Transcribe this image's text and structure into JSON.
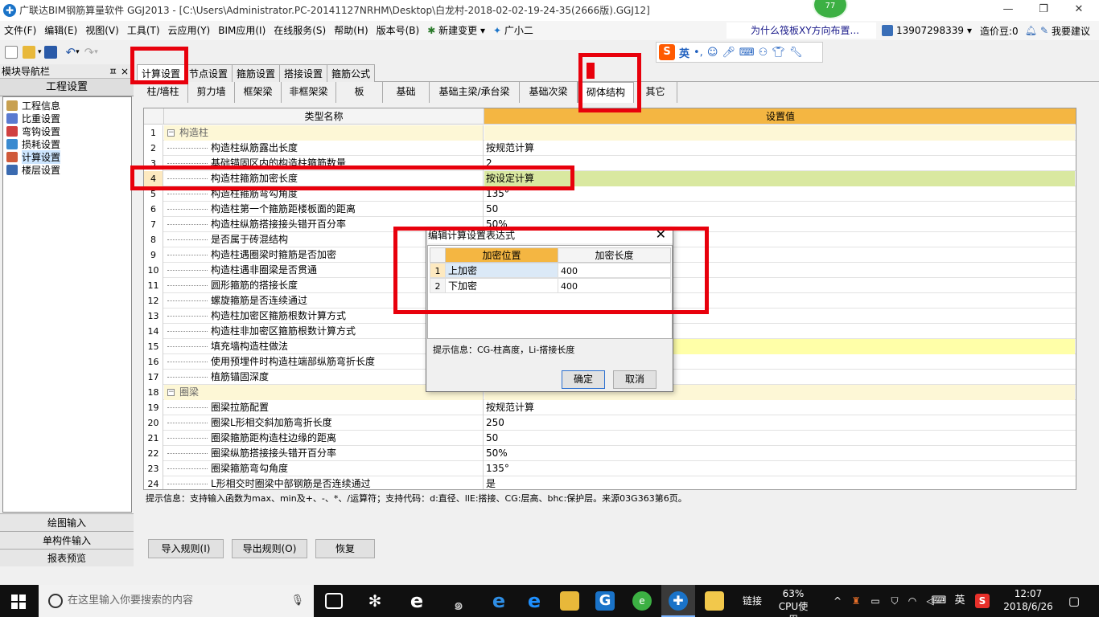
{
  "window": {
    "title": "广联达BIM钢筋算量软件 GGJ2013 - [C:\\Users\\Administrator.PC-20141127NRHM\\Desktop\\白龙村-2018-02-02-19-24-35(2666版).GGJ12]",
    "badge": "77",
    "controls": {
      "minimize": "—",
      "restore": "❐",
      "close": "✕"
    }
  },
  "menu": {
    "items": [
      "文件(F)",
      "编辑(E)",
      "视图(V)",
      "工具(T)",
      "云应用(Y)",
      "BIM应用(I)",
      "在线服务(S)",
      "帮助(H)",
      "版本号(B)",
      "新建变更",
      "广小二"
    ],
    "ad": "为什么筏板XY方向布置...",
    "phone": "13907298339",
    "bean": "造价豆:0",
    "feedback": "我要建议"
  },
  "ime": {
    "lang": "英"
  },
  "nav": {
    "title": "模块导航栏",
    "pin": "ㅍ",
    "close": "×",
    "section": "工程设置",
    "items": [
      "工程信息",
      "比重设置",
      "弯钩设置",
      "损耗设置",
      "计算设置",
      "楼层设置"
    ],
    "bottom": [
      "绘图输入",
      "单构件输入",
      "报表预览"
    ]
  },
  "tabs": [
    "计算设置",
    "节点设置",
    "箍筋设置",
    "搭接设置",
    "箍筋公式"
  ],
  "subtabs": [
    "柱/墙柱",
    "剪力墙",
    "框架梁",
    "非框架梁",
    "板",
    "基础",
    "基础主梁/承台梁",
    "基础次梁",
    "砌体结构",
    "其它"
  ],
  "grid": {
    "col_name": "类型名称",
    "col_value": "设置值",
    "rows": [
      {
        "n": "1",
        "name": "构造柱",
        "value": "",
        "group": true
      },
      {
        "n": "2",
        "name": "构造柱纵筋露出长度",
        "value": "按规范计算"
      },
      {
        "n": "3",
        "name": "基础锚固区内的构造柱箍筋数量",
        "value": "2"
      },
      {
        "n": "4",
        "name": "构造柱箍筋加密长度",
        "value": "按设定计算",
        "selected": true
      },
      {
        "n": "5",
        "name": "构造柱箍筋弯勾角度",
        "value": "135°"
      },
      {
        "n": "6",
        "name": "构造柱第一个箍筋距楼板面的距离",
        "value": "50"
      },
      {
        "n": "7",
        "name": "构造柱纵筋搭接接头错开百分率",
        "value": "50%"
      },
      {
        "n": "8",
        "name": "是否属于砖混结构",
        "value": ""
      },
      {
        "n": "9",
        "name": "构造柱遇圈梁时箍筋是否加密",
        "value": ""
      },
      {
        "n": "10",
        "name": "构造柱遇非圈梁是否贯通",
        "value": ""
      },
      {
        "n": "11",
        "name": "圆形箍筋的搭接长度",
        "value": ""
      },
      {
        "n": "12",
        "name": "螺旋箍筋是否连续通过",
        "value": ""
      },
      {
        "n": "13",
        "name": "构造柱加密区箍筋根数计算方式",
        "value": ""
      },
      {
        "n": "14",
        "name": "构造柱非加密区箍筋根数计算方式",
        "value": ""
      },
      {
        "n": "15",
        "name": "填充墙构造柱做法",
        "value": "",
        "hl": true
      },
      {
        "n": "16",
        "name": "使用预埋件时构造柱端部纵筋弯折长度",
        "value": ""
      },
      {
        "n": "17",
        "name": "植筋锚固深度",
        "value": ""
      },
      {
        "n": "18",
        "name": "圈梁",
        "value": "",
        "group": true
      },
      {
        "n": "19",
        "name": "圈梁拉筋配置",
        "value": "按规范计算"
      },
      {
        "n": "20",
        "name": "圈梁L形相交斜加筋弯折长度",
        "value": "250"
      },
      {
        "n": "21",
        "name": "圈梁箍筋距构造柱边缘的距离",
        "value": "50"
      },
      {
        "n": "22",
        "name": "圈梁纵筋搭接接头错开百分率",
        "value": "50%"
      },
      {
        "n": "23",
        "name": "圈梁箍筋弯勾角度",
        "value": "135°"
      },
      {
        "n": "24",
        "name": "L形相交时圈梁中部钢筋是否连续通过",
        "value": "是"
      }
    ]
  },
  "hint": "提示信息：支持输入函数为max、min及+、-、*、/运算符；支持代码：d:直径、llE:搭接、CG:层高、bhc:保护层。来源03G363第6页。",
  "buttons": {
    "import": "导入规则(I)",
    "export": "导出规则(O)",
    "restore": "恢复"
  },
  "dialog": {
    "title": "编辑计算设置表达式",
    "close": "✕",
    "col_position": "加密位置",
    "col_length": "加密长度",
    "rows": [
      {
        "n": "1",
        "position": "上加密",
        "length": "400"
      },
      {
        "n": "2",
        "position": "下加密",
        "length": "400"
      }
    ],
    "hint": "提示信息：CG-柱高度，Li-搭接长度",
    "ok": "确定",
    "cancel": "取消"
  },
  "taskbar": {
    "search": "在这里输入你要搜索的内容",
    "link": "链接",
    "cpu_pct": "63%",
    "cpu_label": "CPU使用",
    "lang": "英",
    "time": "12:07",
    "date": "2018/6/26"
  },
  "colors": {
    "accent_orange": "#f4b642",
    "selected_row": "#d9e8a0",
    "highlight_row": "#ffffa8",
    "annotation_red": "#e8000c"
  }
}
